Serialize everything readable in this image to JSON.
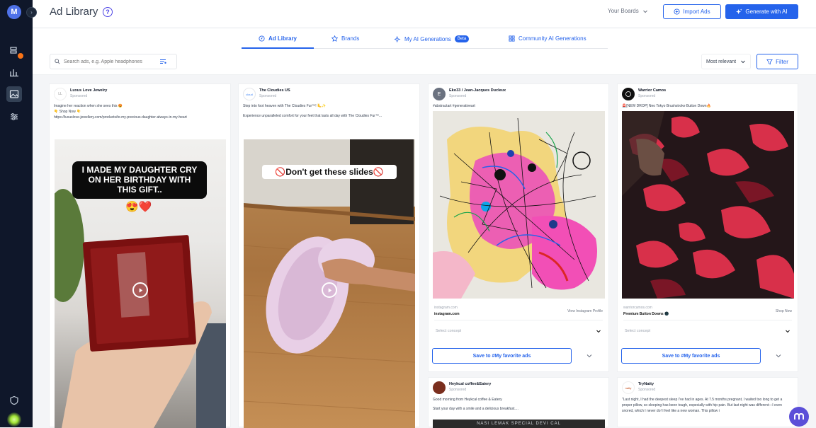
{
  "sidebar": {
    "logo": "M",
    "icons": [
      "layers-icon",
      "bar-chart-icon",
      "image-icon",
      "sliders-icon",
      "shield-icon"
    ]
  },
  "header": {
    "title": "Ad Library",
    "boards_label": "Your Boards",
    "import_label": "Import Ads",
    "generate_label": "Generate with AI"
  },
  "tabs": [
    {
      "label": "Ad Library"
    },
    {
      "label": "Brands"
    },
    {
      "label": "My AI Generations",
      "badge": "Beta"
    },
    {
      "label": "Community AI Generations"
    }
  ],
  "toolbar": {
    "search_placeholder": "Search ads, e.g. Apple headphones",
    "sort_label": "Most relevant",
    "filter_label": "Filter"
  },
  "cards": [
    {
      "name": "Luxus Love Jewelry",
      "sponsored": "Sponsored",
      "text1": "Imagine her reaction when she sees this 😍",
      "text2": "👇 Shop Now 👇",
      "text3": "https://luxuslove-jewellery.com/products/to-my-precious-daughter-always-in-my-heart",
      "overlay": "I MADE MY DAUGHTER CRY ON HER BIRTHDAY WITH THIS GIFT..",
      "emoji": "😍❤️"
    },
    {
      "name": "The Cloudies US",
      "sponsored": "Sponsored",
      "text1": "Step into foot heaven with The Cloudies Fur™! 🦶✨",
      "text2": "Experience unparalleled comfort for your feet that lasts all day with The Cloudies Fur™...",
      "overlay": "🚫Don't get these slides🚫"
    },
    {
      "name": "Eko33 / Jean-Jacques Ducleux",
      "sponsored": "Sponsored",
      "text1": "#abstractart #generativeart",
      "domain": "instagram.com",
      "site": "instagram.com",
      "cta": "View Instagram Profile",
      "concept": "Select concept",
      "save": "Save to #My favorite ads",
      "avatar_letter": "E"
    },
    {
      "name": "Warrior Camos",
      "sponsored": "Sponsored",
      "text1": "🚨[NEW DROP] Neo Tokyo Brushstroke Button Down🔥",
      "domain": "warriorcamos.com",
      "site": "Premium Button Downs 🌑",
      "cta": "Shop Now",
      "concept": "Select concept",
      "save": "Save to #My favorite ads"
    },
    {
      "name": "Heykcal coffee&Eatery",
      "sponsored": "Sponsored",
      "text1": "Good morning from Heykcal coffee & Eatery",
      "text2": "Start your day with a smile and a delicious breakfast....",
      "banner": "NASI LEMAK SPECIAL DEVI CAL"
    },
    {
      "name": "TryNatty",
      "sponsored": "Sponsored",
      "text1": "\"Last night, I had the deepest sleep I've had in ages. At 7.5 months pregnant, I waited too long to get a proper pillow, so sleeping has been tough, especially with hip pain. But last night was different—I even snored, which I never do! I feel like a new woman. This pillow i"
    }
  ]
}
